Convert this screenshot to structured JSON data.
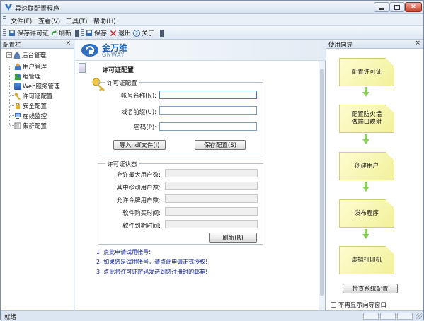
{
  "window": {
    "title": "异速联配置程序"
  },
  "menu": [
    "文件(F)",
    "查看(V)",
    "工具(T)",
    "帮助(H)"
  ],
  "toolbar": {
    "save_license": "保存许可证",
    "refresh": "刷新",
    "save": "保存",
    "exit": "退出",
    "about": "关于"
  },
  "left_pane": {
    "title": "配置栏",
    "root": "后台管理",
    "items": [
      "用户管理",
      "组管理",
      "Web服务管理",
      "许可证配置",
      "安全配置",
      "在线监控",
      "集群配置"
    ]
  },
  "main": {
    "logo_cn": "金万维",
    "logo_en": "GNWAY",
    "section_title": "许可证配置",
    "group1": {
      "title": "许可证配置",
      "account_label": "帐号名称(N):",
      "domain_label": "域名前缀(U):",
      "password_label": "密码(P):",
      "import_button": "导入ndf文件(I)",
      "save_button": "保存配置(S)"
    },
    "group2": {
      "title": "许可证状态",
      "labels": [
        "允许最大用户数:",
        "其中移动用户数:",
        "允许令牌用户数:",
        "软件购买时间:",
        "软件到期时间:"
      ],
      "refresh_button": "刷新(R)"
    },
    "links": [
      "1. 点此申请试用帐号!",
      "2. 如果您是试用帐号，请点此申请正式授权!",
      "3. 点此将许可证密码发送到您注册时的邮箱!"
    ]
  },
  "right_pane": {
    "title": "使用向导",
    "steps": [
      "配置许可证",
      "配置防火墙\n做端口映射",
      "创建用户",
      "发布程序",
      "虚拟打印机"
    ],
    "check_button": "检查系统配置",
    "hide_checkbox": "不再显示向导窗口"
  },
  "status": {
    "text": "就绪"
  }
}
